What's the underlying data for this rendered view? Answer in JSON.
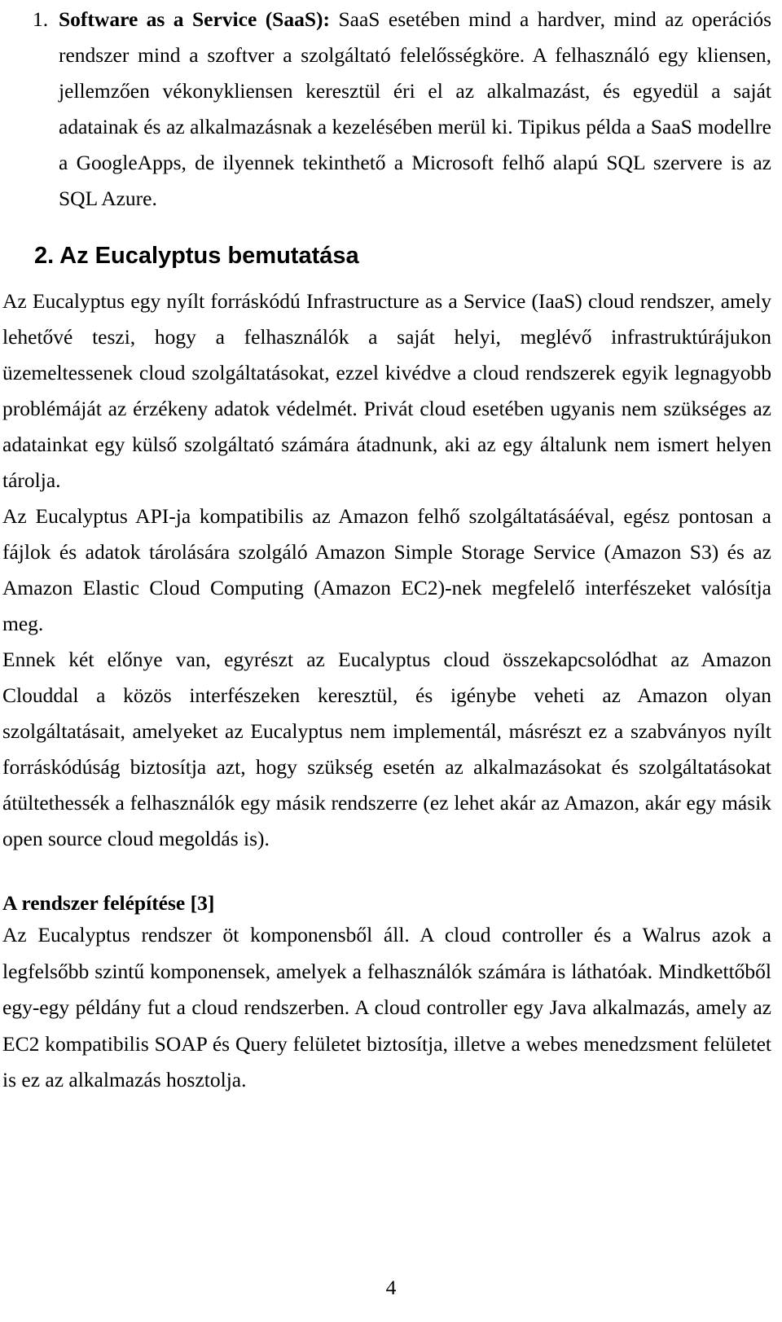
{
  "page": {
    "number": "4",
    "language": "hu"
  },
  "list_item": {
    "marker": "1.",
    "lead_label": "Software as a Service (SaaS):",
    "body": " SaaS esetében mind a hardver, mind az operációs rendszer mind a szoftver a szolgáltató felelősségköre. A felhasználó egy kliensen, jellemzően vékonykliensen keresztül éri el az alkalmazást, és egyedül a saját adatainak és az alkalmazásnak a kezelésében merül ki. Tipikus példa a SaaS modellre a GoogleApps, de ilyennek tekinthető a Microsoft felhő alapú SQL szervere is az SQL Azure."
  },
  "section": {
    "heading": "2. Az Eucalyptus bemutatása",
    "paragraphs": [
      "Az Eucalyptus egy nyílt forráskódú Infrastructure as a Service (IaaS) cloud rendszer, amely lehetővé teszi, hogy a felhasználók a saját helyi, meglévő infrastruktúrájukon üzemeltessenek cloud szolgáltatásokat, ezzel kivédve a cloud rendszerek egyik legnagyobb problémáját az érzékeny adatok védelmét. Privát cloud esetében ugyanis nem szükséges az adatainkat egy külső szolgáltató számára átadnunk, aki az egy általunk nem ismert helyen tárolja.",
      "Az Eucalyptus API-ja kompatibilis az Amazon felhő szolgáltatásáéval, egész pontosan a fájlok és adatok tárolására szolgáló Amazon Simple Storage Service (Amazon S3) és az Amazon Elastic Cloud Computing (Amazon EC2)-nek megfelelő interfészeket valósítja meg.",
      "Ennek két előnye van, egyrészt az Eucalyptus cloud összekapcsolódhat az Amazon Clouddal a közös interfészeken keresztül, és igénybe veheti az Amazon olyan szolgáltatásait, amelyeket az Eucalyptus nem implementál, másrészt ez a szabványos nyílt forráskódúság biztosítja azt, hogy szükség esetén az alkalmazásokat és szolgáltatásokat átültethessék a felhasználók egy másik rendszerre (ez lehet akár az Amazon, akár egy másik open source cloud megoldás is)."
    ]
  },
  "subsection": {
    "heading": "A rendszer felépítése [3]",
    "paragraph": "Az Eucalyptus rendszer öt komponensből áll. A cloud controller és a Walrus azok a legfelsőbb szintű komponensek, amelyek a felhasználók számára is láthatóak. Mindkettőből egy-egy példány fut a cloud rendszerben. A cloud controller egy Java alkalmazás, amely az EC2 kompatibilis SOAP és Query felületet biztosítja, illetve a webes menedzsment felületet is ez az alkalmazás hosztolja."
  }
}
